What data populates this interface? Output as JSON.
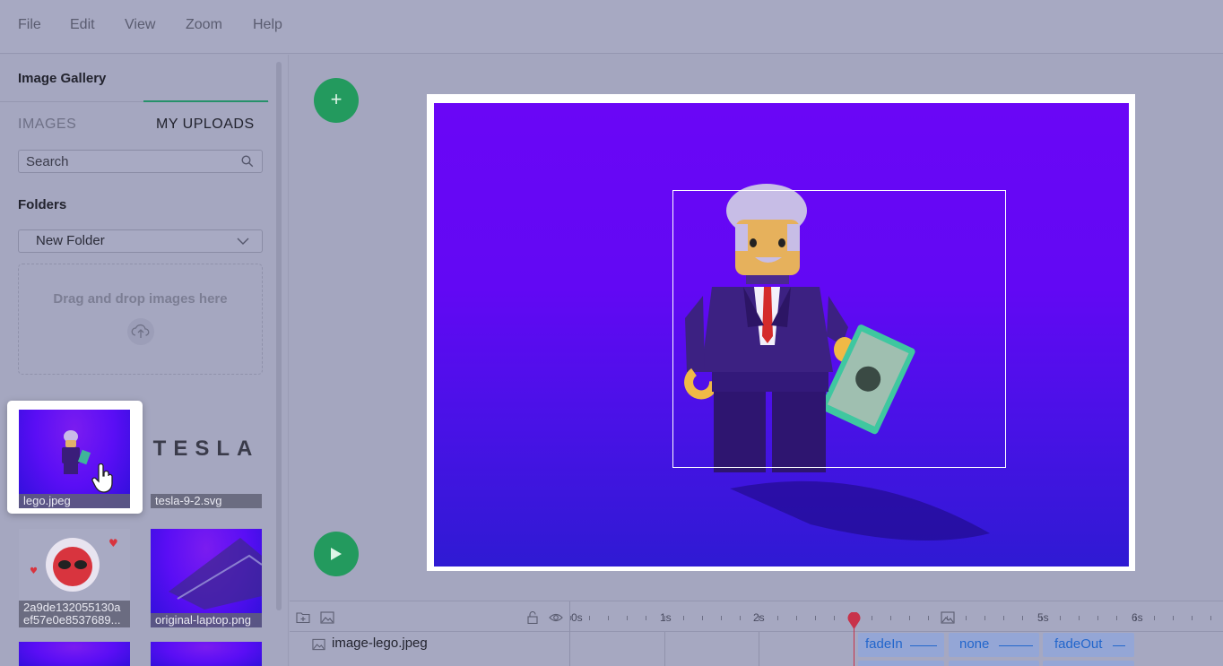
{
  "menu": {
    "file": "File",
    "edit": "Edit",
    "view": "View",
    "zoom": "Zoom",
    "help": "Help"
  },
  "sidebar": {
    "title": "Image Gallery",
    "tabs": {
      "images": "IMAGES",
      "uploads": "MY UPLOADS"
    },
    "search": {
      "placeholder": "Search"
    },
    "folders_label": "Folders",
    "folder_selected": "New Folder",
    "dropzone_text": "Drag and drop images here",
    "thumbnails": [
      {
        "caption": "lego.jpeg"
      },
      {
        "caption": "tesla-9-2.svg",
        "logo_text": "TESLA"
      },
      {
        "caption": "2a9de132055130aef57e0e8537689..."
      },
      {
        "caption": "original-laptop.png"
      }
    ]
  },
  "timeline": {
    "ticks": [
      "0s",
      "1s",
      "2s",
      "5s",
      "6s"
    ],
    "track": {
      "label": "image-lego.jpeg"
    },
    "segments": [
      {
        "label": "fadeIn"
      },
      {
        "label": "none"
      },
      {
        "label": "fadeOut"
      }
    ]
  },
  "colors": {
    "accent_green": "#239a5e",
    "playhead": "#c8324a",
    "segment": "#94a6d6",
    "segment_text": "#2266cc"
  }
}
